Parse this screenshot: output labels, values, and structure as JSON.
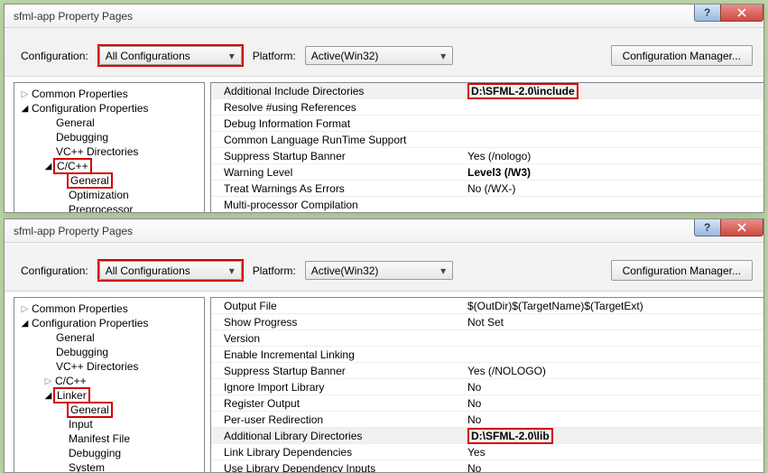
{
  "title": "sfml-app Property Pages",
  "labels": {
    "configuration": "Configuration:",
    "platform": "Platform:",
    "config_manager": "Configuration Manager..."
  },
  "config_value": "All Configurations",
  "platform_value": "Active(Win32)",
  "top": {
    "tree": {
      "common": "Common Properties",
      "config_props": "Configuration Properties",
      "general": "General",
      "debugging": "Debugging",
      "vcdirs": "VC++ Directories",
      "ccpp": "C/C++",
      "ccpp_general": "General",
      "optimization": "Optimization",
      "preprocessor": "Preprocessor"
    },
    "grid": [
      {
        "k": "Additional Include Directories",
        "v": "D:\\SFML-2.0\\include",
        "bold": true,
        "boxed": true,
        "selected": true
      },
      {
        "k": "Resolve #using References",
        "v": ""
      },
      {
        "k": "Debug Information Format",
        "v": ""
      },
      {
        "k": "Common Language RunTime Support",
        "v": ""
      },
      {
        "k": "Suppress Startup Banner",
        "v": "Yes (/nologo)"
      },
      {
        "k": "Warning Level",
        "v": "Level3 (/W3)",
        "bold": true
      },
      {
        "k": "Treat Warnings As Errors",
        "v": "No (/WX-)"
      },
      {
        "k": "Multi-processor Compilation",
        "v": ""
      }
    ]
  },
  "bottom": {
    "tree": {
      "common": "Common Properties",
      "config_props": "Configuration Properties",
      "general": "General",
      "debugging": "Debugging",
      "vcdirs": "VC++ Directories",
      "ccpp": "C/C++",
      "linker": "Linker",
      "linker_general": "General",
      "input": "Input",
      "manifest": "Manifest File",
      "linker_debugging": "Debugging",
      "system": "System"
    },
    "grid": [
      {
        "k": "Output File",
        "v": "$(OutDir)$(TargetName)$(TargetExt)"
      },
      {
        "k": "Show Progress",
        "v": "Not Set"
      },
      {
        "k": "Version",
        "v": ""
      },
      {
        "k": "Enable Incremental Linking",
        "v": ""
      },
      {
        "k": "Suppress Startup Banner",
        "v": "Yes (/NOLOGO)"
      },
      {
        "k": "Ignore Import Library",
        "v": "No"
      },
      {
        "k": "Register Output",
        "v": "No"
      },
      {
        "k": "Per-user Redirection",
        "v": "No"
      },
      {
        "k": "Additional Library Directories",
        "v": "D:\\SFML-2.0\\lib",
        "bold": true,
        "boxed": true,
        "selected": true
      },
      {
        "k": "Link Library Dependencies",
        "v": "Yes"
      },
      {
        "k": "Use Library Dependency Inputs",
        "v": "No"
      }
    ]
  }
}
